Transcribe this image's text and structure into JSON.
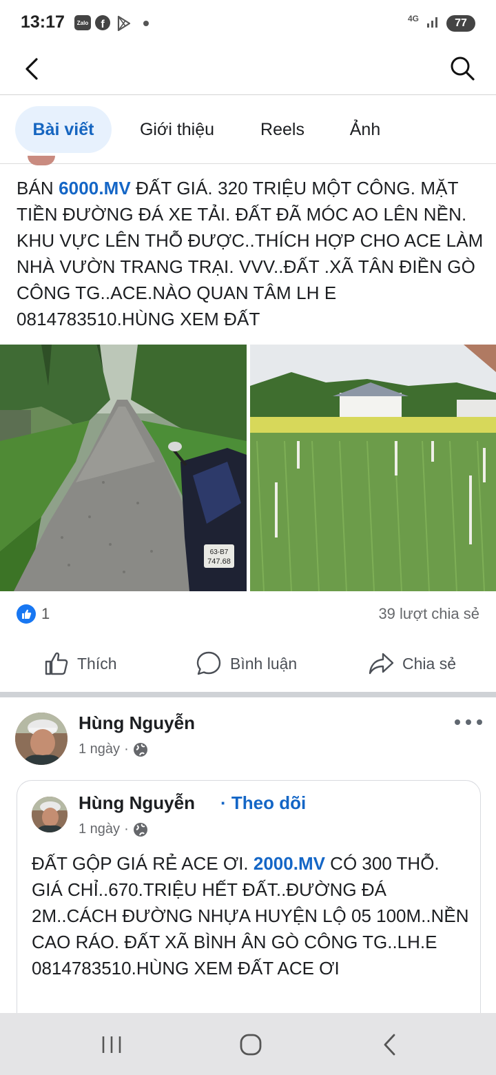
{
  "status_bar": {
    "time": "13:17",
    "zalo_label": "Zalo",
    "network": "4G",
    "battery": "77",
    "icons": [
      "zalo-icon",
      "facebook-icon",
      "play-store-icon",
      "notification-dot-icon",
      "signal-icon",
      "battery-icon"
    ]
  },
  "header": {
    "back_icon": "back-arrow-icon",
    "search_icon": "search-icon"
  },
  "tabs": [
    {
      "label": "Bài viết",
      "active": true
    },
    {
      "label": "Giới thiệu",
      "active": false
    },
    {
      "label": "Reels",
      "active": false
    },
    {
      "label": "Ảnh",
      "active": false
    }
  ],
  "post1": {
    "text_before": "BÁN ",
    "tag": "6000.MV",
    "text_after": " ĐẤT GIÁ. 320 TRIỆU MỘT CÔNG. MẶT TIỀN ĐƯỜNG ĐÁ XE TẢI. ĐẤT ĐÃ MÓC AO LÊN NỀN. KHU VỰC LÊN THỖ ĐƯỢC..THÍCH HỢP CHO ACE LÀM NHÀ VƯỜN TRANG TRẠI. VVV..ĐẤT .XÃ TÂN ĐIỀN GÒ CÔNG TG..ACE.NÀO QUAN TÂM LH E 0814783510.HÙNG XEM ĐẤT",
    "photo_plate": "63-B7\n747.68",
    "like_count": "1",
    "share_count": "39 lượt chia sẻ",
    "actions": {
      "like": "Thích",
      "comment": "Bình luận",
      "share": "Chia sẻ"
    }
  },
  "post2": {
    "author": "Hùng Nguyễn",
    "time": "1 ngày",
    "dot": "·",
    "shared": {
      "author": "Hùng Nguyễn",
      "follow": "· Theo dõi",
      "time": "1 ngày",
      "dot": "·",
      "text_before": "ĐẤT GỘP GIÁ RẺ ACE ƠI. ",
      "tag": "2000.MV",
      "text_after": " CÓ 300 THỖ. GIÁ CHỈ..670.TRIỆU HẾT ĐẤT..ĐƯỜNG ĐÁ 2M..CÁCH ĐƯỜNG NHỰA HUYỆN LỘ 05 100M..NỀN CAO RÁO. ĐẤT XÃ BÌNH ÂN GÒ CÔNG TG..LH.E 0814783510.HÙNG XEM ĐẤT ACE ƠI"
    }
  },
  "colors": {
    "accent": "#1466c6",
    "tab_active_bg": "#e7f1fd",
    "like_blue": "#1877f2"
  }
}
